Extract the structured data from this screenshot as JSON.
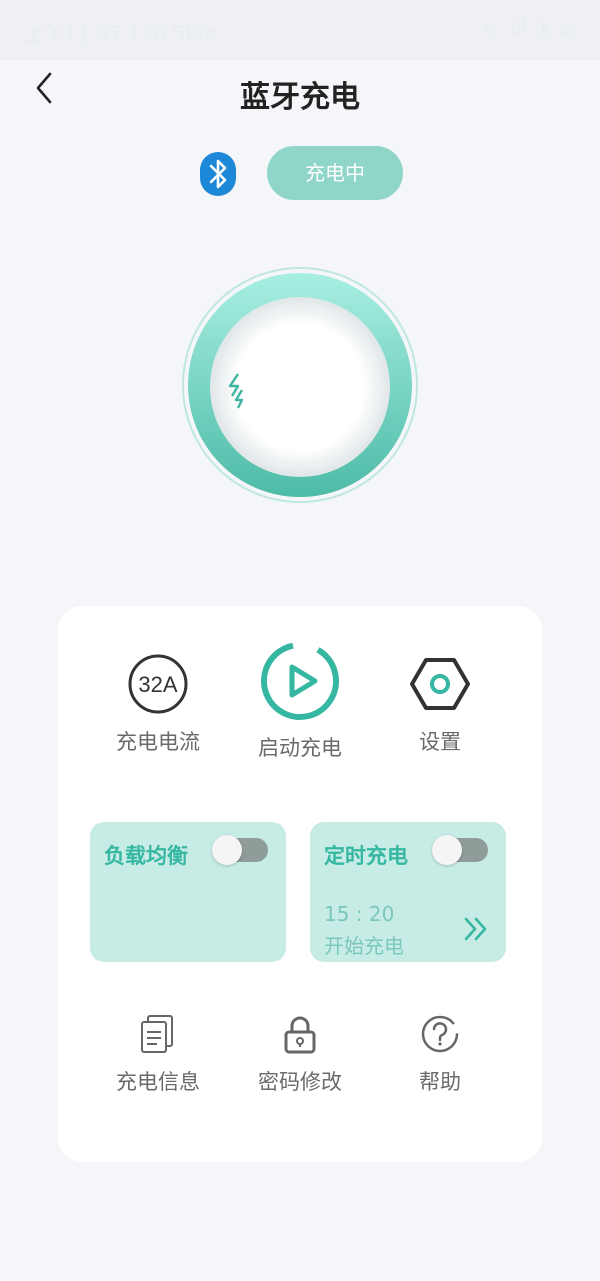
{
  "statusbar": {
    "left_text": "上午11:37 136.5K/s",
    "right_text": "≋ .ıll ◔ ▭"
  },
  "header": {
    "title": "蓝牙充电"
  },
  "bluetooth": {
    "state_label": "充电中"
  },
  "functions": {
    "current_badge": "32A",
    "current_label": "充电电流",
    "start_label": "启动充电",
    "settings_label": "设置"
  },
  "tiles": {
    "load_balance": {
      "title": "负载均衡"
    },
    "timed_charge": {
      "title": "定时充电",
      "time": "15 : 20",
      "subtitle": "开始充电"
    }
  },
  "bottom": {
    "info_label": "充电信息",
    "password_label": "密码修改",
    "help_label": "帮助"
  },
  "colors": {
    "accent": "#35b7a2",
    "pill": "#8fd6c8",
    "tile": "#c7ece6",
    "bt_blue": "#1e88d8"
  }
}
